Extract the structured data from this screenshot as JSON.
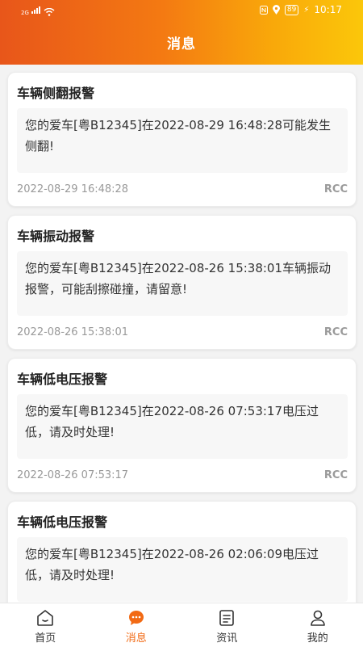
{
  "status": {
    "network": "2G",
    "battery": "89",
    "time": "10:17"
  },
  "header": {
    "title": "消息"
  },
  "messages": [
    {
      "title": "车辆侧翻报警",
      "body": "您的爱车[粤B12345]在2022-08-29 16:48:28可能发生侧翻!",
      "time": "2022-08-29 16:48:28",
      "source": "RCC"
    },
    {
      "title": "车辆振动报警",
      "body": "您的爱车[粤B12345]在2022-08-26 15:38:01车辆振动报警，可能刮擦碰撞，请留意!",
      "time": "2022-08-26 15:38:01",
      "source": "RCC"
    },
    {
      "title": "车辆低电压报警",
      "body": "您的爱车[粤B12345]在2022-08-26 07:53:17电压过低，请及时处理!",
      "time": "2022-08-26 07:53:17",
      "source": "RCC"
    },
    {
      "title": "车辆低电压报警",
      "body": "您的爱车[粤B12345]在2022-08-26 02:06:09电压过低，请及时处理!",
      "time": "",
      "source": ""
    }
  ],
  "tabbar": {
    "items": [
      {
        "label": "首页",
        "icon": "home-icon"
      },
      {
        "label": "消息",
        "icon": "message-icon"
      },
      {
        "label": "资讯",
        "icon": "news-icon"
      },
      {
        "label": "我的",
        "icon": "profile-icon"
      }
    ],
    "active_color": "#f26a14"
  }
}
